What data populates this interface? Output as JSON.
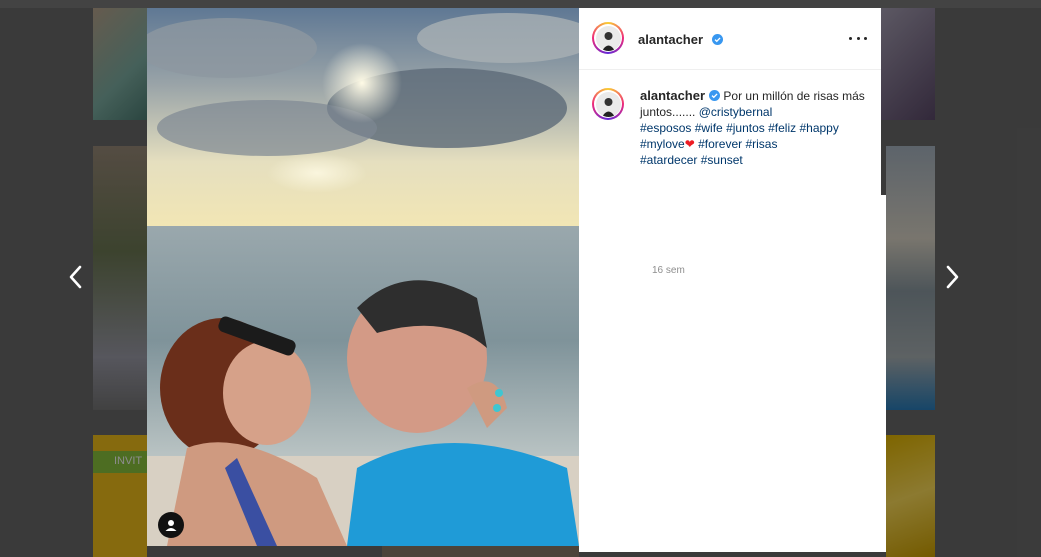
{
  "post": {
    "username": "alantacher",
    "verified": true,
    "caption": {
      "text_before": "Por un millón de risas más juntos....... ",
      "mention": "@cristybernal",
      "hashtags_line1": [
        "#esposos",
        "#wife",
        "#juntos",
        "#feliz",
        "#happy"
      ],
      "mylove": "#mylove",
      "heart": "❤",
      "hashtags_line2": [
        "#forever",
        "#risas"
      ],
      "hashtags_line3": [
        "#atardecer",
        "#sunset"
      ]
    },
    "time_ago": "16 sem"
  },
  "background": {
    "tile_text": "INVIT"
  },
  "icons": {
    "prev": "chevron-left-icon",
    "next": "chevron-right-icon",
    "more": "more-options-icon",
    "tag": "user-tag-icon",
    "verified": "verified-badge-icon"
  },
  "colors": {
    "verified": "#3897f0",
    "hashtag": "#00376b",
    "heart": "#ed1c24"
  }
}
